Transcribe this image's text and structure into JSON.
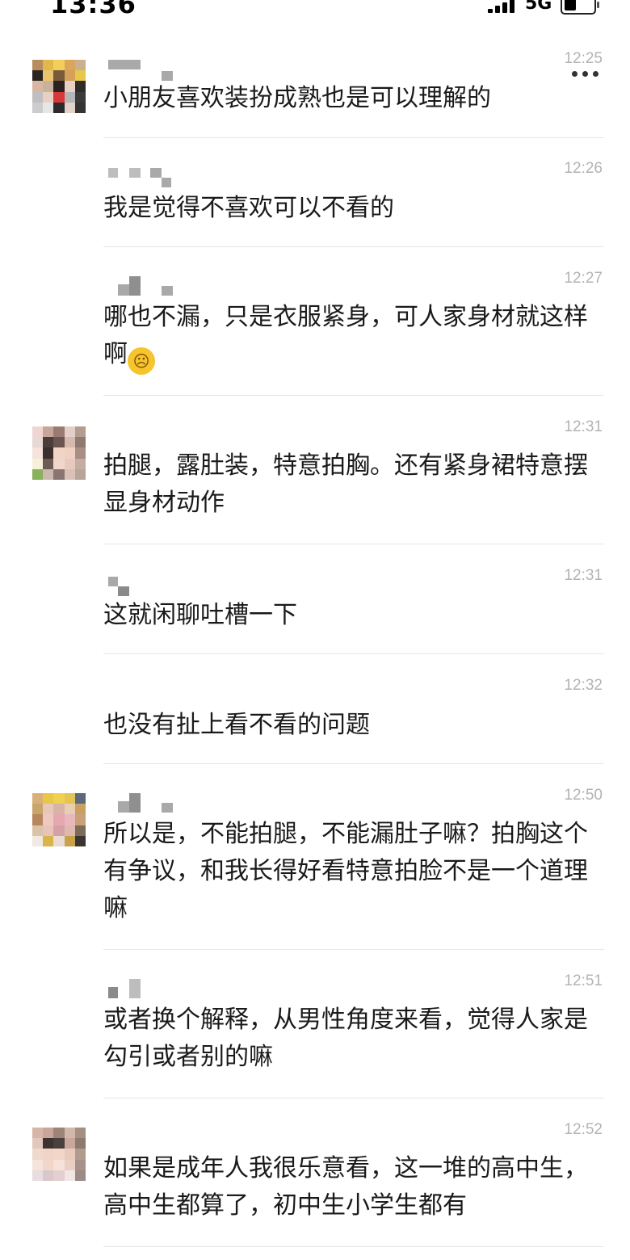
{
  "status_bar": {
    "time": "13:36",
    "network": "5G"
  },
  "comments": [
    {
      "time": "12:25",
      "text": "小朋友喜欢装扮成熟也是可以理解的",
      "has_avatar": true
    },
    {
      "time": "12:26",
      "text": "我是觉得不喜欢可以不看的",
      "has_avatar": false
    },
    {
      "time": "12:27",
      "text": "哪也不漏，只是衣服紧身，可人家身材就这样啊",
      "emoji": "crying-face-emoji",
      "has_avatar": false
    },
    {
      "time": "12:31",
      "text": "拍腿，露肚装，特意拍胸。还有紧身裙特意摆显身材动作",
      "has_avatar": true
    },
    {
      "time": "12:31",
      "text": "这就闲聊吐槽一下",
      "has_avatar": false
    },
    {
      "time": "12:32",
      "text": "也没有扯上看不看的问题",
      "has_avatar": false
    },
    {
      "time": "12:50",
      "text": "所以是，不能拍腿，不能漏肚子嘛？拍胸这个有争议，和我长得好看特意拍脸不是一个道理嘛",
      "has_avatar": true
    },
    {
      "time": "12:51",
      "text": "或者换个解释，从男性角度来看，觉得人家是勾引或者别的嘛",
      "has_avatar": false
    },
    {
      "time": "12:52",
      "text": "如果是成年人我很乐意看，这一堆的高中生，高中生都算了，初中生小学生都有",
      "has_avatar": true
    }
  ],
  "colors": {
    "time": "#b3b3b3",
    "text": "#1a1a1a",
    "divider": "#e6e6e6"
  }
}
